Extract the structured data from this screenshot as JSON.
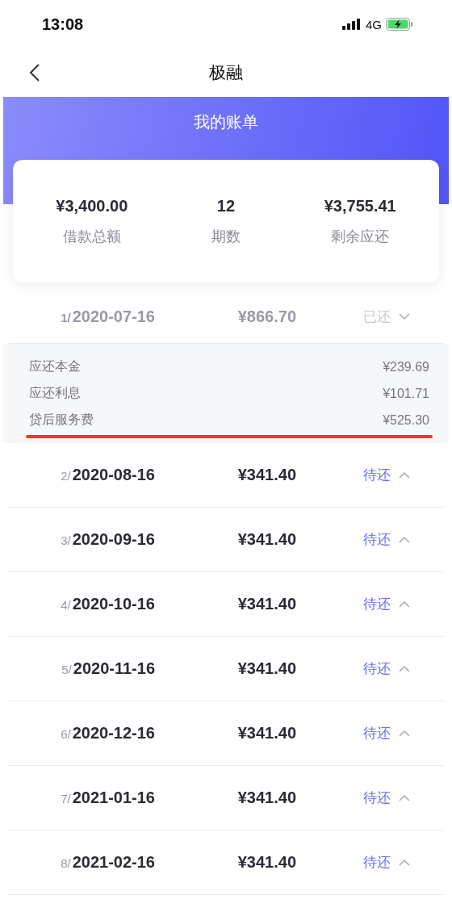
{
  "status_bar": {
    "time": "13:08",
    "network": "4G"
  },
  "nav": {
    "title": "极融"
  },
  "banner": {
    "title": "我的账单"
  },
  "summary": [
    {
      "value": "¥3,400.00",
      "label": "借款总额"
    },
    {
      "value": "12",
      "label": "期数"
    },
    {
      "value": "¥3,755.41",
      "label": "剩余应还"
    }
  ],
  "installments": [
    {
      "index": "1/",
      "date": "2020-07-16",
      "amount": "¥866.70",
      "status": "已还",
      "paid": true,
      "expanded": true,
      "details": [
        {
          "label": "应还本金",
          "value": "¥239.69",
          "underlined": false
        },
        {
          "label": "应还利息",
          "value": "¥101.71",
          "underlined": false
        },
        {
          "label": "贷后服务费",
          "value": "¥525.30",
          "underlined": true
        }
      ]
    },
    {
      "index": "2/",
      "date": "2020-08-16",
      "amount": "¥341.40",
      "status": "待还",
      "paid": false,
      "expanded": false
    },
    {
      "index": "3/",
      "date": "2020-09-16",
      "amount": "¥341.40",
      "status": "待还",
      "paid": false,
      "expanded": false
    },
    {
      "index": "4/",
      "date": "2020-10-16",
      "amount": "¥341.40",
      "status": "待还",
      "paid": false,
      "expanded": false
    },
    {
      "index": "5/",
      "date": "2020-11-16",
      "amount": "¥341.40",
      "status": "待还",
      "paid": false,
      "expanded": false
    },
    {
      "index": "6/",
      "date": "2020-12-16",
      "amount": "¥341.40",
      "status": "待还",
      "paid": false,
      "expanded": false
    },
    {
      "index": "7/",
      "date": "2021-01-16",
      "amount": "¥341.40",
      "status": "待还",
      "paid": false,
      "expanded": false
    },
    {
      "index": "8/",
      "date": "2021-02-16",
      "amount": "¥341.40",
      "status": "待还",
      "paid": false,
      "expanded": false
    }
  ]
}
